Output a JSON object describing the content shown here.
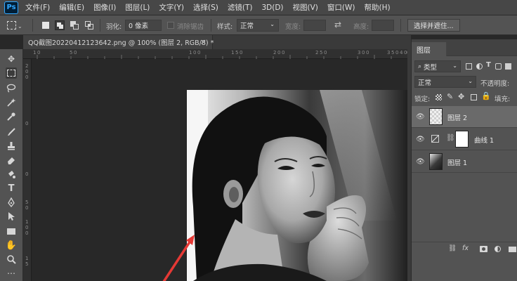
{
  "app": {
    "logo": "Ps"
  },
  "menu": [
    "文件(F)",
    "编辑(E)",
    "图像(I)",
    "图层(L)",
    "文字(Y)",
    "选择(S)",
    "滤镜(T)",
    "3D(D)",
    "视图(V)",
    "窗口(W)",
    "帮助(H)"
  ],
  "options": {
    "feather_label": "羽化:",
    "feather_value": "0 像素",
    "antialias_label": "消除锯齿",
    "style_label": "样式:",
    "style_value": "正常",
    "width_label": "宽度:",
    "height_label": "高度:",
    "select_mask_button": "选择并遮住..."
  },
  "document": {
    "tab_title": "QQ截图20220412123642.png @ 100% (图层 2, RGB/8) *",
    "close_glyph": "×"
  },
  "rulers": {
    "top": [
      "1",
      "0",
      "5",
      "0",
      "1",
      "0",
      "0",
      "1",
      "5",
      "0",
      "2",
      "0",
      "0",
      "2",
      "5",
      "0",
      "3",
      "0",
      "0",
      "3",
      "5",
      "0",
      "4",
      "0",
      "0"
    ],
    "left": [
      "2",
      "0",
      "0",
      "0",
      "0",
      "5",
      "0",
      "1",
      "0",
      "0",
      "1",
      "5"
    ]
  },
  "layers_panel": {
    "tab": "图层",
    "filter_value": "类型",
    "blend_mode": "正常",
    "opacity_label": "不透明度:",
    "lock_label": "锁定:",
    "fill_label": "填充:",
    "layers": [
      {
        "name": "图层 2",
        "selected": true
      },
      {
        "name": "曲线 1",
        "selected": false
      },
      {
        "name": "图层 1",
        "selected": false
      }
    ],
    "footer_fx": "fx"
  },
  "colors": {
    "menubar": "#474747",
    "panel": "#535353",
    "accent_arrow": "#e53935",
    "selected_layer": "#6a6a6a"
  }
}
